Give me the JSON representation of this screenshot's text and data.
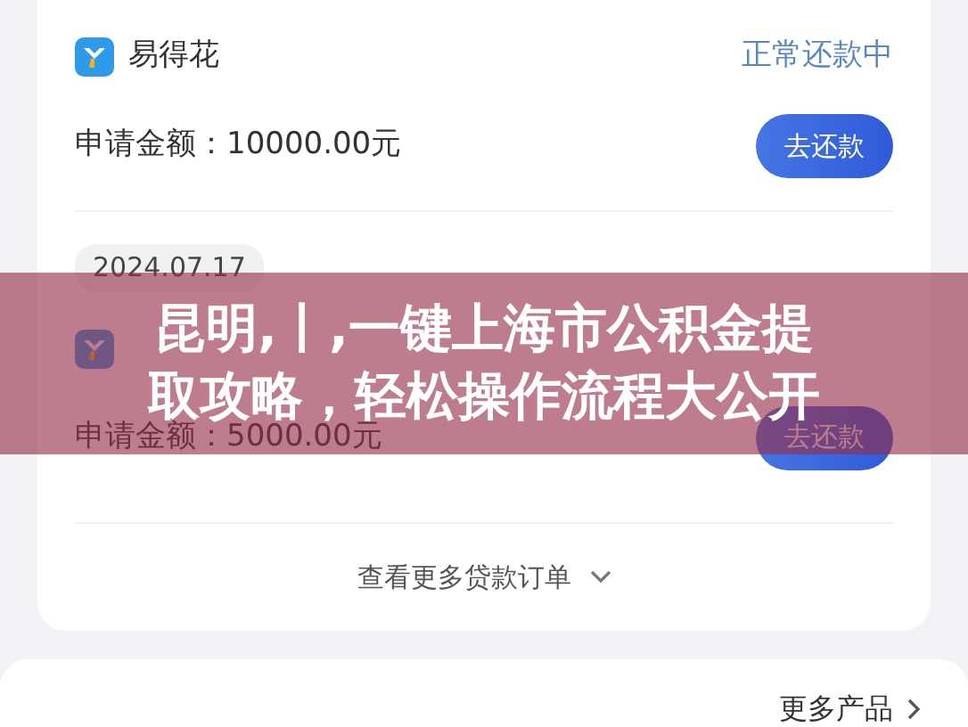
{
  "loans": [
    {
      "app_name": "易得花",
      "status": "正常还款中",
      "amount": "申请金额：10000.00元",
      "button": "去还款"
    },
    {
      "date": "2024.07.17",
      "amount": "申请金额：5000.00元",
      "button": "去还款"
    }
  ],
  "more_orders": "查看更多贷款订单",
  "more_products": "更多产品",
  "banner": {
    "lines": [
      "昆明,丨,一键上海市公积金提",
      "取攻略，轻松操作流程大公开"
    ]
  }
}
